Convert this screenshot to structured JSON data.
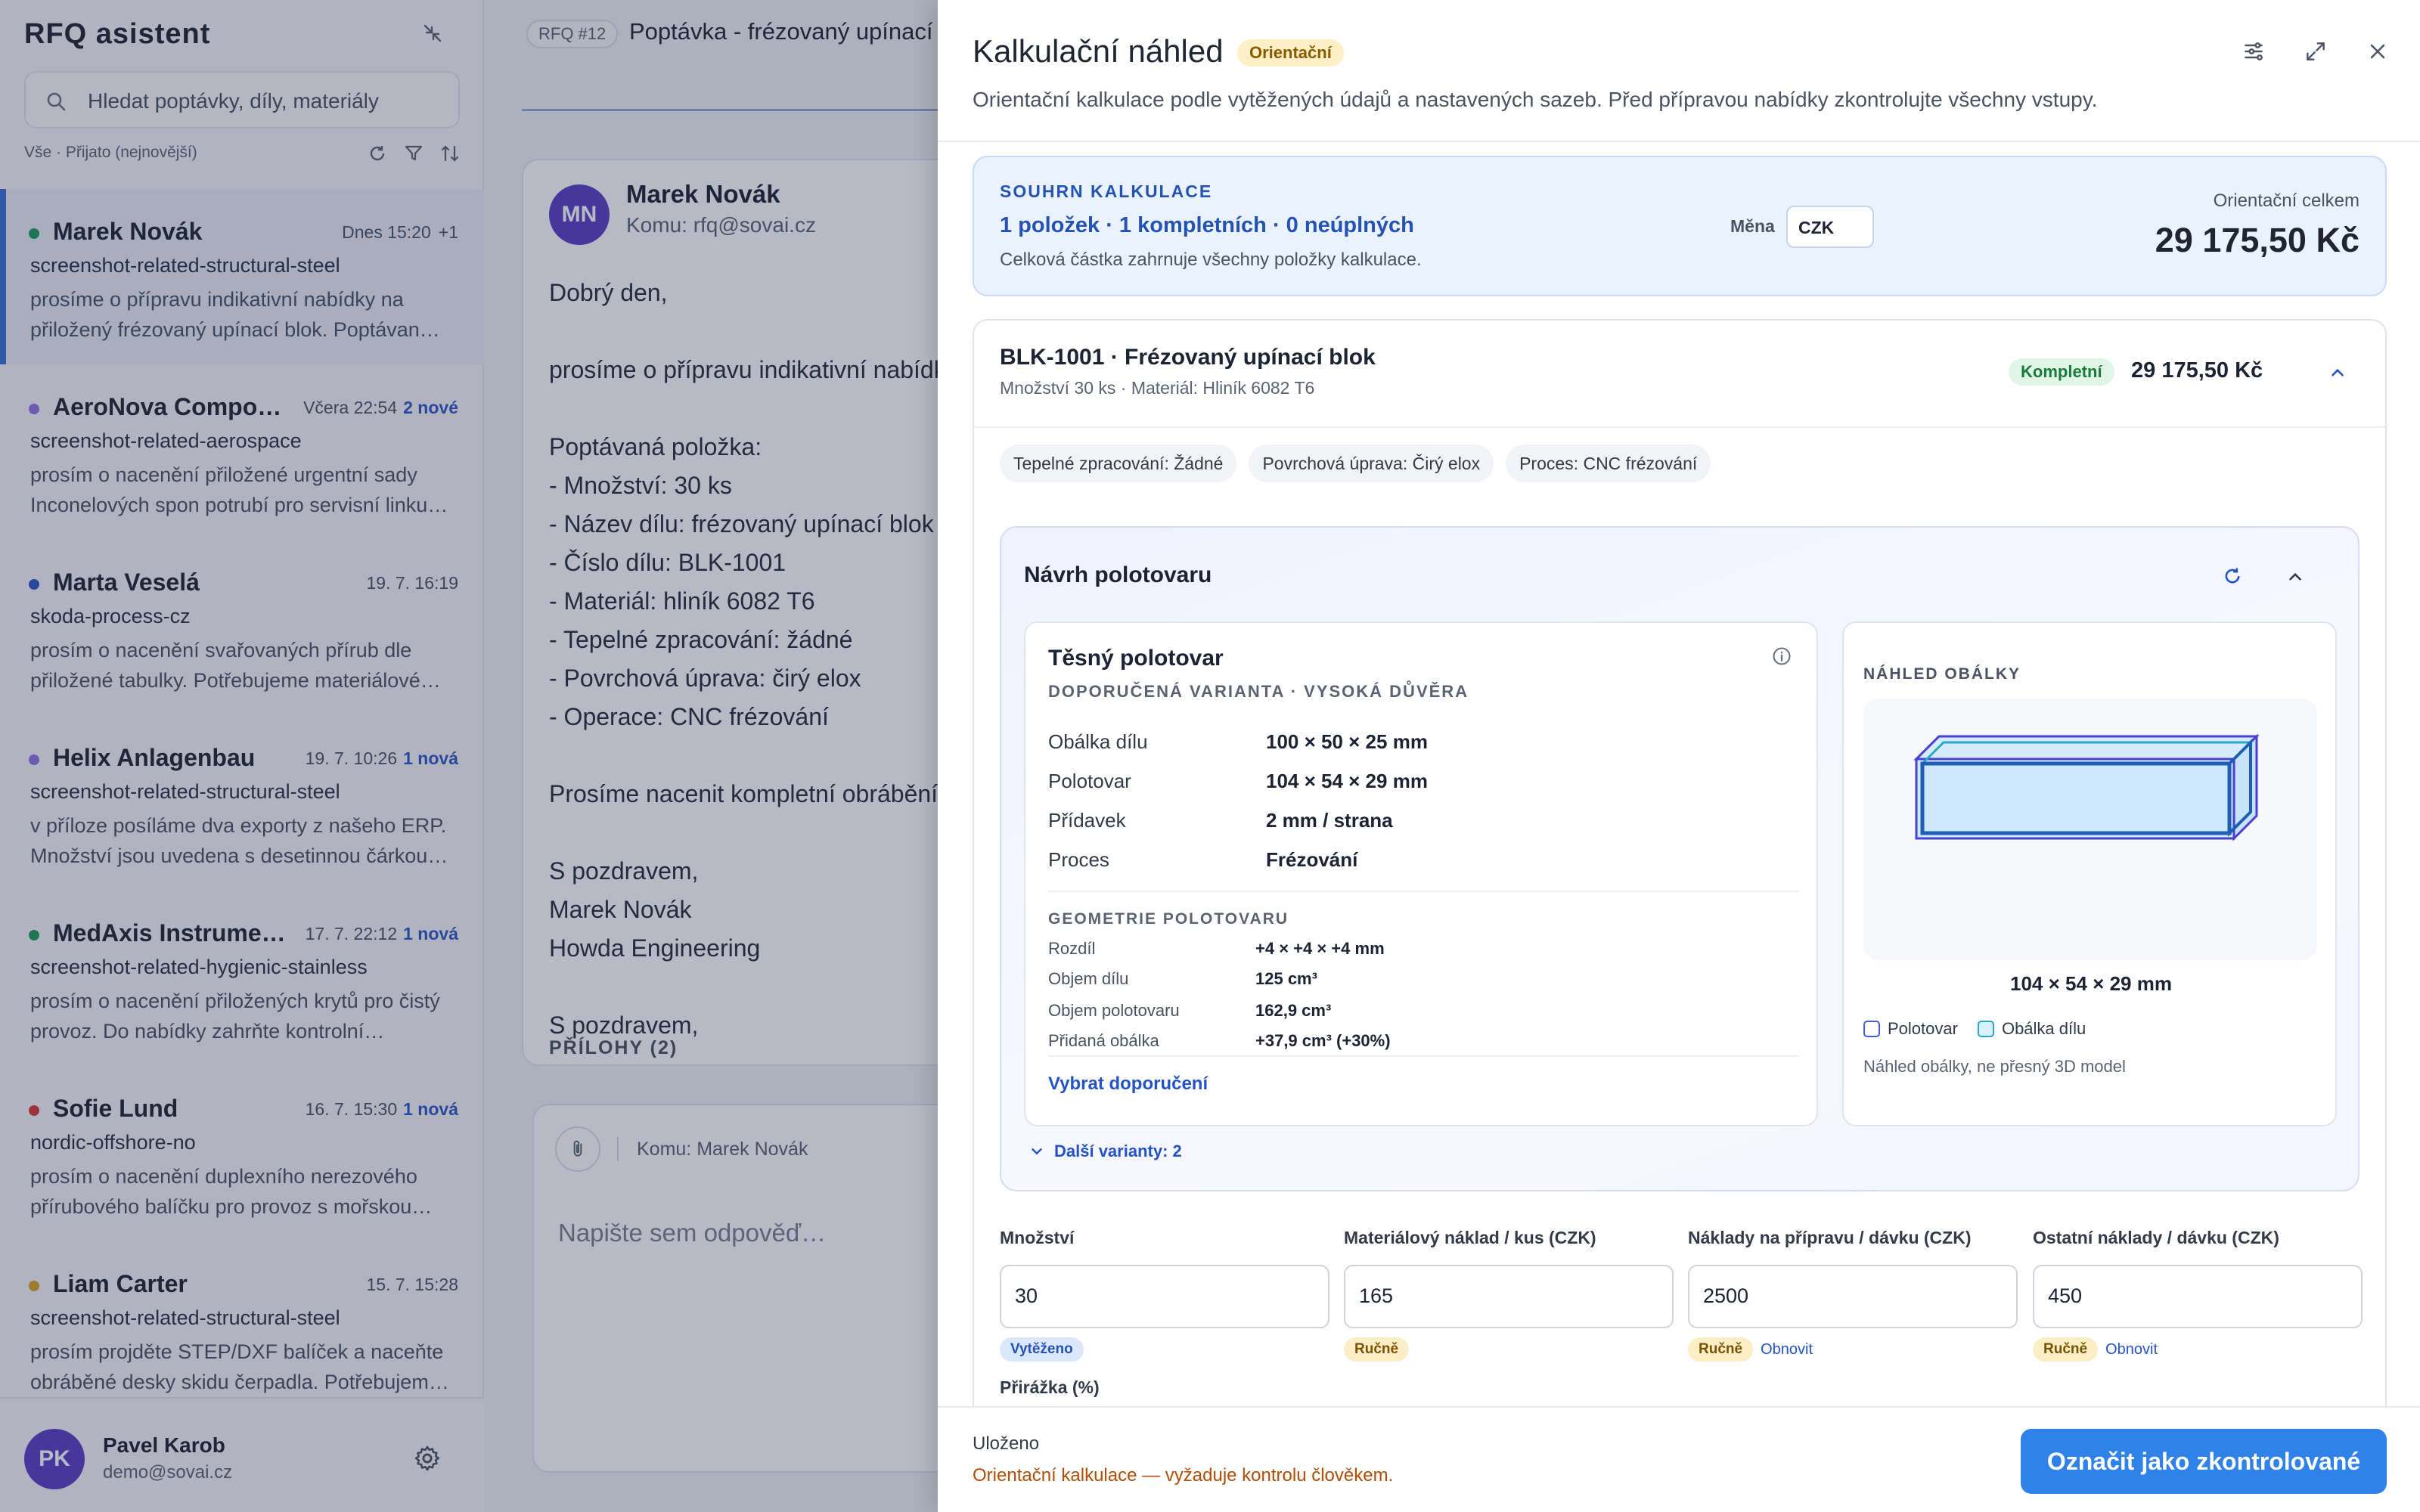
{
  "sidebar": {
    "brand": "RFQ asistent",
    "search_placeholder": "Hledat poptávky, díly, materiály",
    "filter_label": "Vše · Přijato (nejnovější)",
    "items": [
      {
        "name": "Marek Novák",
        "time": "Dnes 15:20",
        "extra": "+1",
        "tag": "screenshot-related-structural-steel",
        "preview": "prosíme o přípravu indikativní nabídky na přiložený frézovaný upínací blok. Poptávan…",
        "dot": "#1f9d57"
      },
      {
        "name": "AeroNova Compo…",
        "time": "Včera 22:54",
        "badge": "2 nové",
        "tag": "screenshot-related-aerospace",
        "preview": "prosím o nacenění přiložené urgentní sady Inconelových spon potrubí pro servisní linku…",
        "dot": "#8f72e0"
      },
      {
        "name": "Marta Veselá",
        "time": "19. 7. 16:19",
        "tag": "skoda-process-cz",
        "preview": "prosím o nacenění svařovaných přírub dle přiložené tabulky. Potřebujeme materiálové…",
        "dot": "#2f56c5"
      },
      {
        "name": "Helix Anlagenbau",
        "time": "19. 7. 10:26",
        "badge": "1 nová",
        "tag": "screenshot-related-structural-steel",
        "preview": "v příloze posíláme dva exporty z našeho ERP. Množství jsou uvedena s desetinnou čárkou…",
        "dot": "#8f72e0"
      },
      {
        "name": "MedAxis Instrume…",
        "time": "17. 7. 22:12",
        "badge": "1 nová",
        "tag": "screenshot-related-hygienic-stainless",
        "preview": "prosím o nacenění přiložených krytů pro čistý provoz. Do nabídky zahrňte kontrolní…",
        "dot": "#1f9d57"
      },
      {
        "name": "Sofie Lund",
        "time": "16. 7. 15:30",
        "badge": "1 nová",
        "tag": "nordic-offshore-no",
        "preview": "prosím o nacenění duplexního nerezového přírubového balíčku pro provoz s mořskou…",
        "dot": "#d33a3a"
      },
      {
        "name": "Liam Carter",
        "time": "15. 7. 15:28",
        "tag": "screenshot-related-structural-steel",
        "preview": "prosím projděte STEP/DXF balíček a naceňte obráběné desky skidu čerpadla. Potřebujem…",
        "dot": "#d8a21c"
      }
    ],
    "user": {
      "initials": "PK",
      "name": "Pavel Karob",
      "email": "demo@sovai.cz"
    }
  },
  "mail": {
    "rfq_pill": "RFQ #12",
    "title": "Poptávka - frézovaný upínací b",
    "sender_initials": "MN",
    "sender": "Marek Novák",
    "to": "Komu: rfq@sovai.cz",
    "body": "Dobrý den,\n\nprosíme o přípravu indikativní nabídk\n\nPoptávaná položka:\n- Množství: 30 ks\n- Název dílu: frézovaný upínací blok\n- Číslo dílu: BLK-1001\n- Materiál: hliník 6082 T6\n- Tepelné zpracování: žádné\n- Povrchová úprava: čirý elox\n- Operace: CNC frézování\n\nProsíme nacenit kompletní obrábění\n\nS pozdravem,\nMarek Novák\nHowda Engineering\n\nS pozdravem,",
    "attachments": "PŘÍLOHY (2)",
    "reply_to": "Komu: Marek Novák",
    "reply_placeholder": "Napište sem odpověď…"
  },
  "drawer": {
    "title": "Kalkulační náhled",
    "badge": "Orientační",
    "subtitle": "Orientační kalkulace podle vytěžených údajů a nastavených sazeb. Před přípravou nabídky zkontrolujte všechny vstupy.",
    "summary": {
      "label": "SOUHRN KALKULACE",
      "counts": "1 položek · 1 kompletních · 0 neúplných",
      "note": "Celková částka zahrnuje všechny položky kalkulace.",
      "currency_label": "Měna",
      "currency": "CZK",
      "total_label": "Orientační celkem",
      "total": "29 175,50 Kč"
    },
    "part": {
      "title": "BLK-1001 · Frézovaný upínací blok",
      "meta": "Množství 30 ks · Materiál: Hliník 6082 T6",
      "status": "Kompletní",
      "price": "29 175,50 Kč",
      "chips": [
        "Tepelné zpracování: Žádné",
        "Povrchová úprava: Čirý elox",
        "Proces: CNC frézování"
      ]
    },
    "blank": {
      "title": "Návrh polotovaru",
      "tight_title": "Těsný polotovar",
      "tight_sub": "DOPORUČENÁ VARIANTA · VYSOKÁ DŮVĚRA",
      "rows": [
        {
          "k": "Obálka dílu",
          "v": "100 × 50 × 25 mm"
        },
        {
          "k": "Polotovar",
          "v": "104 × 54 × 29 mm"
        },
        {
          "k": "Přídavek",
          "v": "2 mm / strana"
        },
        {
          "k": "Proces",
          "v": "Frézování"
        }
      ],
      "geo_label": "GEOMETRIE POLOTOVARU",
      "geo": [
        {
          "k": "Rozdíl",
          "v": "+4 × +4 × +4 mm"
        },
        {
          "k": "Objem dílu",
          "v": "125 cm³"
        },
        {
          "k": "Objem polotovaru",
          "v": "162,9 cm³"
        },
        {
          "k": "Přidaná obálka",
          "v": "+37,9 cm³ (+30%)"
        }
      ],
      "pick": "Vybrat doporučení",
      "preview_label": "NÁHLED OBÁLKY",
      "preview_dim": "104 × 54 × 29 mm",
      "legend_stock": "Polotovar",
      "legend_env": "Obálka dílu",
      "preview_note": "Náhled obálky, ne přesný 3D model",
      "more": "Další varianty: 2"
    },
    "fields": [
      {
        "label": "Množství",
        "value": "30",
        "status": "Vytěženo",
        "refresh": ""
      },
      {
        "label": "Materiálový náklad / kus (CZK)",
        "value": "165",
        "status": "Ručně",
        "refresh": ""
      },
      {
        "label": "Náklady na přípravu / dávku (CZK)",
        "value": "2500",
        "status": "Ručně",
        "refresh": "Obnovit"
      },
      {
        "label": "Ostatní náklady / dávku (CZK)",
        "value": "450",
        "status": "Ručně",
        "refresh": "Obnovit"
      }
    ],
    "markup_label": "Přirážka (%)",
    "footer": {
      "saved": "Uloženo",
      "warning": "Orientační kalkulace — vyžaduje kontrolu člověkem.",
      "button": "Označit jako zkontrolované"
    }
  }
}
